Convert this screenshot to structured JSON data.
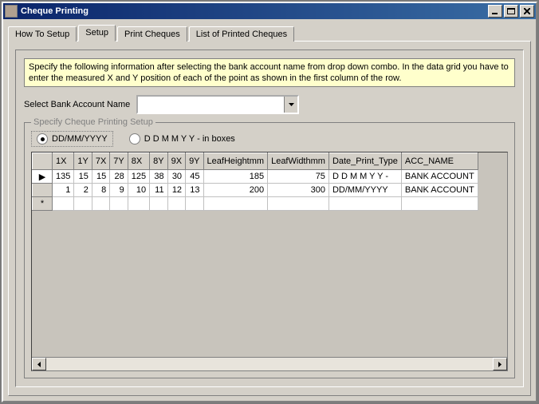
{
  "window": {
    "title": "Cheque Printing"
  },
  "tabs": {
    "items": [
      {
        "label": "How To Setup"
      },
      {
        "label": "Setup"
      },
      {
        "label": "Print Cheques"
      },
      {
        "label": "List of Printed Cheques"
      }
    ],
    "active_index": 1
  },
  "info_text": "Specify the following information after selecting the bank account name from drop down combo. In the data grid you have to enter the measured X and Y position of each of the point as shown in the first column of the row.",
  "bank_select": {
    "label": "Select Bank Account Name",
    "value": ""
  },
  "fieldset_title": "Specify Cheque Printing Setup",
  "date_formats": {
    "opt1": "DD/MM/YYYY",
    "opt2": "D D M M Y Y -  in boxes",
    "selected": "opt1"
  },
  "grid": {
    "columns": [
      "1X",
      "1Y",
      "7X",
      "7Y",
      "8X",
      "8Y",
      "9X",
      "9Y",
      "LeafHeightmm",
      "LeafWidthmm",
      "Date_Print_Type",
      "ACC_NAME"
    ],
    "rows": [
      {
        "1X": "135",
        "1Y": "15",
        "7X": "15",
        "7Y": "28",
        "8X": "125",
        "8Y": "38",
        "9X": "30",
        "9Y": "45",
        "LeafHeightmm": "185",
        "LeafWidthmm": "75",
        "Date_Print_Type": "D D M M Y Y -",
        "ACC_NAME": "BANK ACCOUNT"
      },
      {
        "1X": "1",
        "1Y": "2",
        "7X": "8",
        "7Y": "9",
        "8X": "10",
        "8Y": "11",
        "9X": "12",
        "9Y": "13",
        "LeafHeightmm": "200",
        "LeafWidthmm": "300",
        "Date_Print_Type": "DD/MM/YYYY",
        "ACC_NAME": "BANK ACCOUNT"
      }
    ]
  }
}
